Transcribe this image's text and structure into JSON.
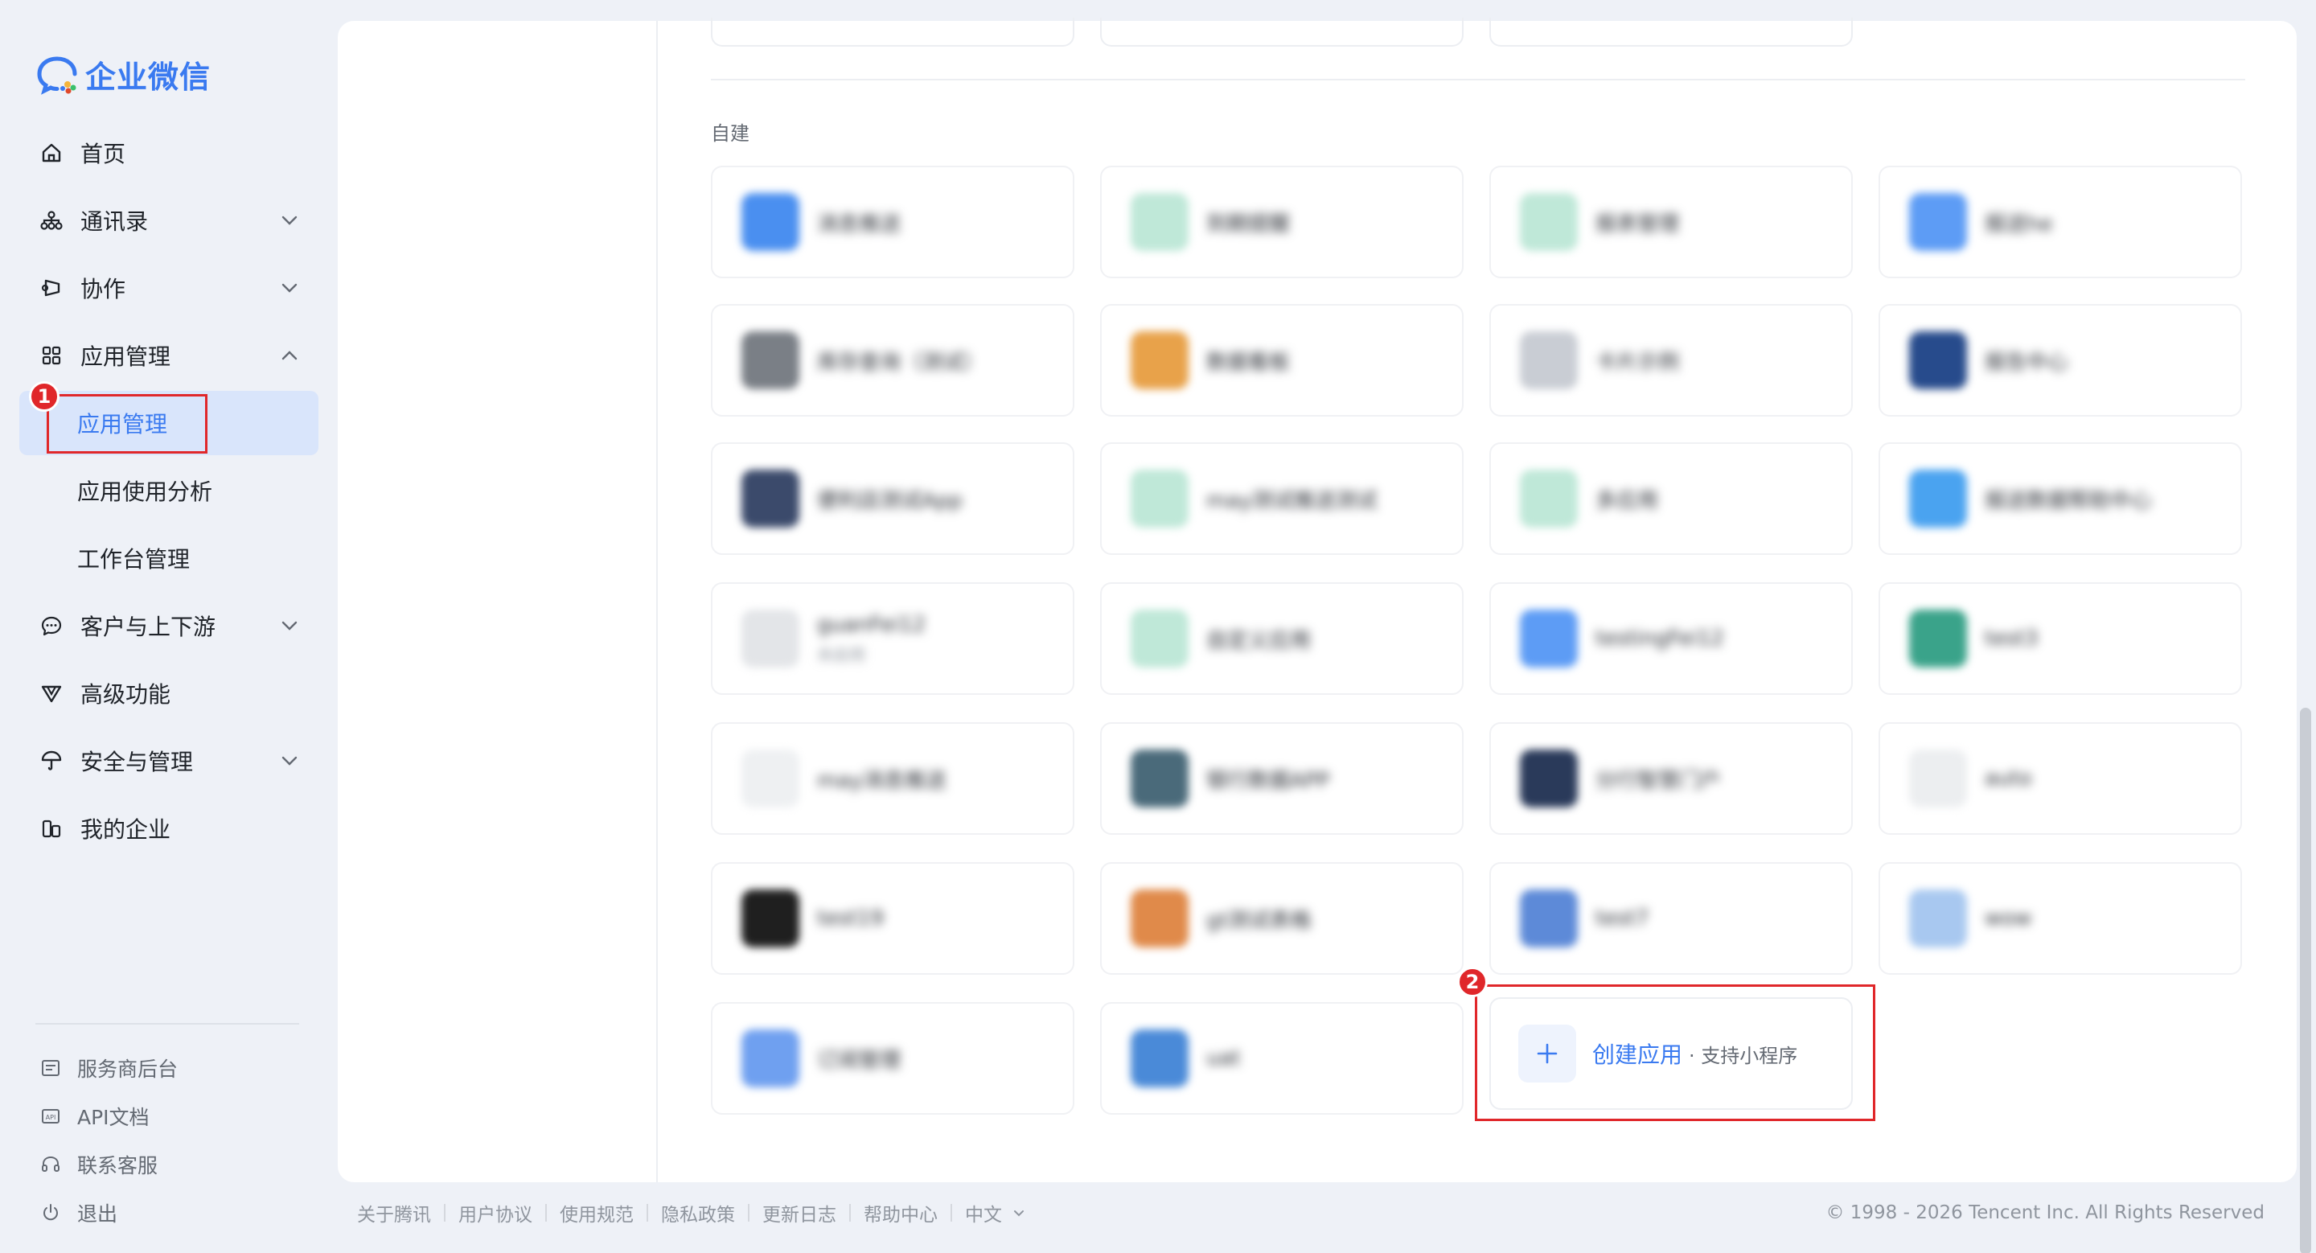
{
  "brand": {
    "name": "企业微信",
    "accent": "#3a7af0"
  },
  "sidebar": {
    "items": [
      {
        "label": "首页",
        "icon": "home-icon",
        "expandable": false
      },
      {
        "label": "通讯录",
        "icon": "org-chart-icon",
        "expandable": true,
        "expanded": false
      },
      {
        "label": "协作",
        "icon": "collab-icon",
        "expandable": true,
        "expanded": false
      },
      {
        "label": "应用管理",
        "icon": "grid-icon",
        "expandable": true,
        "expanded": true
      },
      {
        "label": "应用管理",
        "sub": true,
        "active": true
      },
      {
        "label": "应用使用分析",
        "sub": true
      },
      {
        "label": "工作台管理",
        "sub": true
      },
      {
        "label": "客户与上下游",
        "icon": "chat-icon",
        "expandable": true,
        "expanded": false
      },
      {
        "label": "高级功能",
        "icon": "advanced-icon",
        "expandable": false
      },
      {
        "label": "安全与管理",
        "icon": "umbrella-icon",
        "expandable": true,
        "expanded": false
      },
      {
        "label": "我的企业",
        "icon": "building-icon",
        "expandable": false
      }
    ],
    "bottom": [
      {
        "label": "服务商后台",
        "icon": "service-icon"
      },
      {
        "label": "API文档",
        "icon": "api-icon"
      },
      {
        "label": "联系客服",
        "icon": "headset-icon"
      },
      {
        "label": "退出",
        "icon": "power-icon"
      }
    ]
  },
  "annotations": {
    "step1": "1",
    "step2": "2",
    "color": "#e0272a"
  },
  "main": {
    "section_title": "自建",
    "apps": [
      {
        "name": "消息推送",
        "color": "#4a8ff0"
      },
      {
        "name": "到期提醒",
        "color": "#bfe8d8"
      },
      {
        "name": "报表管理",
        "color": "#bfe8d8"
      },
      {
        "name": "报送he",
        "color": "#5d9cf5"
      },
      {
        "name": "库存查询（测试）",
        "color": "#7a7f86"
      },
      {
        "name": "数据看板",
        "color": "#e8a24a"
      },
      {
        "name": "卡片示例",
        "color": "#c9cdd4"
      },
      {
        "name": "报告中心",
        "color": "#274b8c"
      },
      {
        "name": "便利店测试App",
        "color": "#3b4a6b"
      },
      {
        "name": "may测试推送测试",
        "color": "#bfe8d8"
      },
      {
        "name": "多应用",
        "color": "#bfe8d8"
      },
      {
        "name": "报送数据帮助中心",
        "color": "#4aa3f0"
      },
      {
        "name": "guanFei12",
        "sub": "未启用",
        "color": "#e3e5e8"
      },
      {
        "name": "自定义应用",
        "color": "#bfe8d8"
      },
      {
        "name": "testingFei12",
        "color": "#5d9cf5"
      },
      {
        "name": "test3",
        "color": "#3aa38a"
      },
      {
        "name": "may消息推送",
        "color": "#eef0f2"
      },
      {
        "name": "银行数据APP",
        "color": "#4a6a7a"
      },
      {
        "name": "分行智慧门户",
        "color": "#2a3a5a"
      },
      {
        "name": "auto",
        "color": "#eceef0"
      },
      {
        "name": "test19",
        "color": "#1f1f1f"
      },
      {
        "name": "gt测试表格",
        "color": "#e08a4a"
      },
      {
        "name": "test7",
        "color": "#5d8ad8"
      },
      {
        "name": "wow",
        "color": "#a8c8f0"
      },
      {
        "name": "订阅管理",
        "color": "#6fa0f0"
      },
      {
        "name": "uat",
        "color": "#4a8ad8"
      }
    ],
    "create": {
      "label": "创建应用",
      "sub": "· 支持小程序"
    }
  },
  "footer": {
    "links": [
      "关于腾讯",
      "用户协议",
      "使用规范",
      "隐私政策",
      "更新日志",
      "帮助中心"
    ],
    "language": "中文",
    "copyright": "© 1998 - 2026 Tencent Inc. All Rights Reserved"
  }
}
